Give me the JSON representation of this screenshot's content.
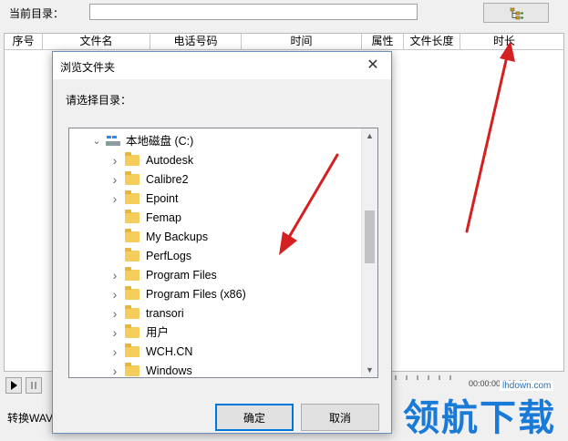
{
  "main": {
    "dir_label": "当前目录：",
    "dir_value": "",
    "columns": [
      "序号",
      "文件名",
      "电话号码",
      "时间",
      "属性",
      "文件长度",
      "时长"
    ],
    "time_readout": "00:00:00 / 00:00",
    "convert_label": "转换WAV"
  },
  "dialog": {
    "title": "浏览文件夹",
    "close_glyph": "✕",
    "prompt": "请选择目录：",
    "root": {
      "label": "本地磁盘 (C:)",
      "expanded": true
    },
    "folders": [
      {
        "label": "Autodesk",
        "has_children": true
      },
      {
        "label": "Calibre2",
        "has_children": true
      },
      {
        "label": "Epoint",
        "has_children": true
      },
      {
        "label": "Femap",
        "has_children": false
      },
      {
        "label": "My Backups",
        "has_children": false
      },
      {
        "label": "PerfLogs",
        "has_children": false
      },
      {
        "label": "Program Files",
        "has_children": true
      },
      {
        "label": "Program Files (x86)",
        "has_children": true
      },
      {
        "label": "transori",
        "has_children": true
      },
      {
        "label": "用户",
        "has_children": true
      },
      {
        "label": "WCH.CN",
        "has_children": true
      },
      {
        "label": "Windows",
        "has_children": true
      }
    ],
    "ok_label": "确定",
    "cancel_label": "取消"
  },
  "watermark": {
    "text": "领航下载",
    "url": "lhdown.com"
  },
  "colors": {
    "dialog_border": "#6c8ebf",
    "default_button_border": "#0078d7",
    "folder": "#f5cd5c",
    "annotation_arrow": "#d42020",
    "watermark": "#1a7ad8"
  }
}
